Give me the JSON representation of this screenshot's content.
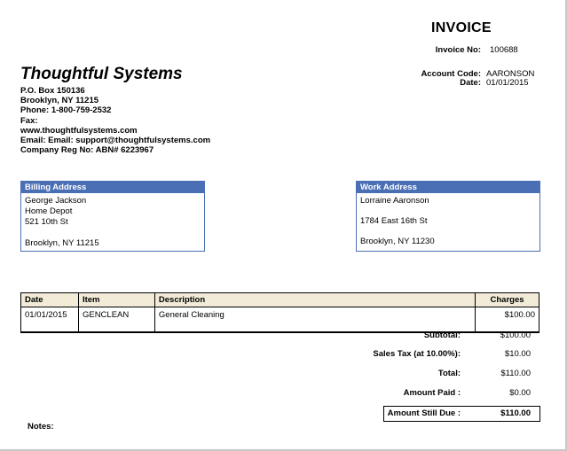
{
  "invoice": {
    "title": "INVOICE",
    "number_label": "Invoice No:",
    "number": "100688",
    "account_code_label": "Account Code:",
    "account_code": "AARONSON",
    "date_label": "Date:",
    "date": "01/01/2015"
  },
  "company": {
    "name": "Thoughtful Systems",
    "lines": [
      "P.O. Box 150136",
      "Brooklyn, NY  11215",
      "Phone: 1-800-759-2532",
      "Fax:",
      "www.thoughtfulsystems.com",
      "Email: Email: support@thoughtfulsystems.com",
      "Company Reg No: ABN# 6223967"
    ]
  },
  "billing": {
    "header": "Billing Address",
    "lines": [
      "George Jackson",
      "Home Depot",
      "521 10th St",
      "",
      "Brooklyn, NY 11215"
    ]
  },
  "work": {
    "header": "Work Address",
    "lines": [
      "Lorraine Aaronson",
      "",
      "1784 East 16th St",
      "",
      "Brooklyn, NY 11230"
    ]
  },
  "items": {
    "headers": [
      "Date",
      "Item",
      "Description",
      "Charges"
    ],
    "rows": [
      {
        "date": "01/01/2015",
        "item": "GENCLEAN",
        "description": "General Cleaning",
        "charges": "$100.00"
      }
    ]
  },
  "totals": {
    "subtotal_label": "Subtotal:",
    "subtotal": "$100.00",
    "tax_label": "Sales Tax (at  10.00%):",
    "tax": "$10.00",
    "total_label": "Total:",
    "total": "$110.00",
    "paid_label": "Amount Paid :",
    "paid": "$0.00",
    "due_label": "Amount Still Due :",
    "due": "$110.00"
  },
  "notes_label": "Notes:"
}
